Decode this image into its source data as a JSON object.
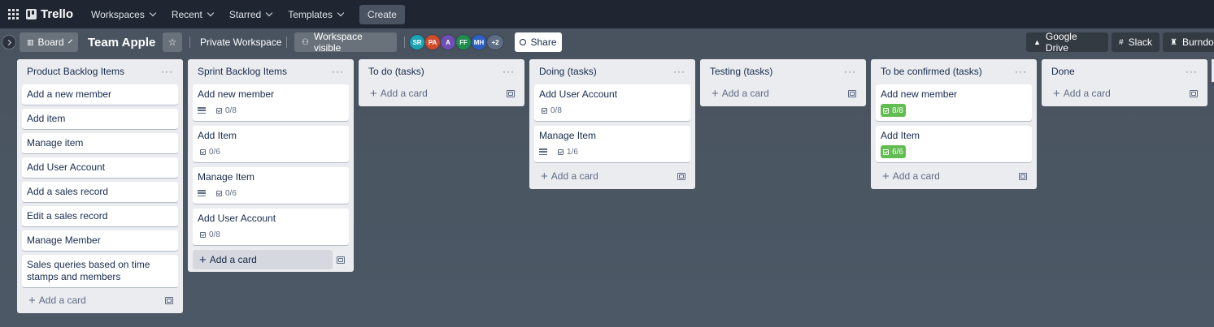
{
  "topnav": {
    "app_name": "Trello",
    "menus": [
      "Workspaces",
      "Recent",
      "Starred",
      "Templates"
    ],
    "create_label": "Create"
  },
  "board_header": {
    "view_label": "Board",
    "title": "Team Apple",
    "workspace_label": "Private Workspace",
    "visibility_label": "Workspace visible",
    "members": [
      {
        "initials": "SR",
        "color": "#1ba2b3"
      },
      {
        "initials": "PA",
        "color": "#d04a2c"
      },
      {
        "initials": "A",
        "color": "#6f4fb4"
      },
      {
        "initials": "FF",
        "color": "#1e8c4d"
      },
      {
        "initials": "MH",
        "color": "#2d5fc4"
      }
    ],
    "more_members": "+2",
    "share_label": "Share",
    "powerups": [
      "Google Drive",
      "Slack",
      "Burndo"
    ]
  },
  "lists": [
    {
      "title": "Product Backlog Items",
      "cards": [
        {
          "title": "Add a new member"
        },
        {
          "title": "Add item"
        },
        {
          "title": "Manage item"
        },
        {
          "title": "Add User Account"
        },
        {
          "title": "Add a sales record"
        },
        {
          "title": "Edit a sales record"
        },
        {
          "title": "Manage Member"
        },
        {
          "title": "Sales queries based on time stamps and members"
        }
      ],
      "add_label": "Add a card"
    },
    {
      "title": "Sprint Backlog Items",
      "cards": [
        {
          "title": "Add new member",
          "desc": true,
          "checklist": "0/8"
        },
        {
          "title": "Add Item",
          "checklist": "0/6"
        },
        {
          "title": "Manage Item",
          "desc": true,
          "checklist": "0/6"
        },
        {
          "title": "Add User Account",
          "checklist": "0/8"
        }
      ],
      "add_label": "Add a card"
    },
    {
      "title": "To do (tasks)",
      "cards": [],
      "add_label": "Add a card"
    },
    {
      "title": "Doing (tasks)",
      "cards": [
        {
          "title": "Add User Account",
          "checklist": "0/8"
        },
        {
          "title": "Manage Item",
          "desc": true,
          "checklist": "1/6"
        }
      ],
      "add_label": "Add a card"
    },
    {
      "title": "Testing (tasks)",
      "cards": [],
      "add_label": "Add a card"
    },
    {
      "title": "To be confirmed (tasks)",
      "cards": [
        {
          "title": "Add new member",
          "checklist": "8/8",
          "complete": true
        },
        {
          "title": "Add Item",
          "checklist": "6/6",
          "complete": true
        }
      ],
      "add_label": "Add a card"
    },
    {
      "title": "Done",
      "cards": [],
      "add_label": "Add a card"
    }
  ],
  "colors": {
    "nav_bg": "#1f2631",
    "list_bg": "#ebecf0",
    "checklist_complete": "#61bd4f"
  }
}
